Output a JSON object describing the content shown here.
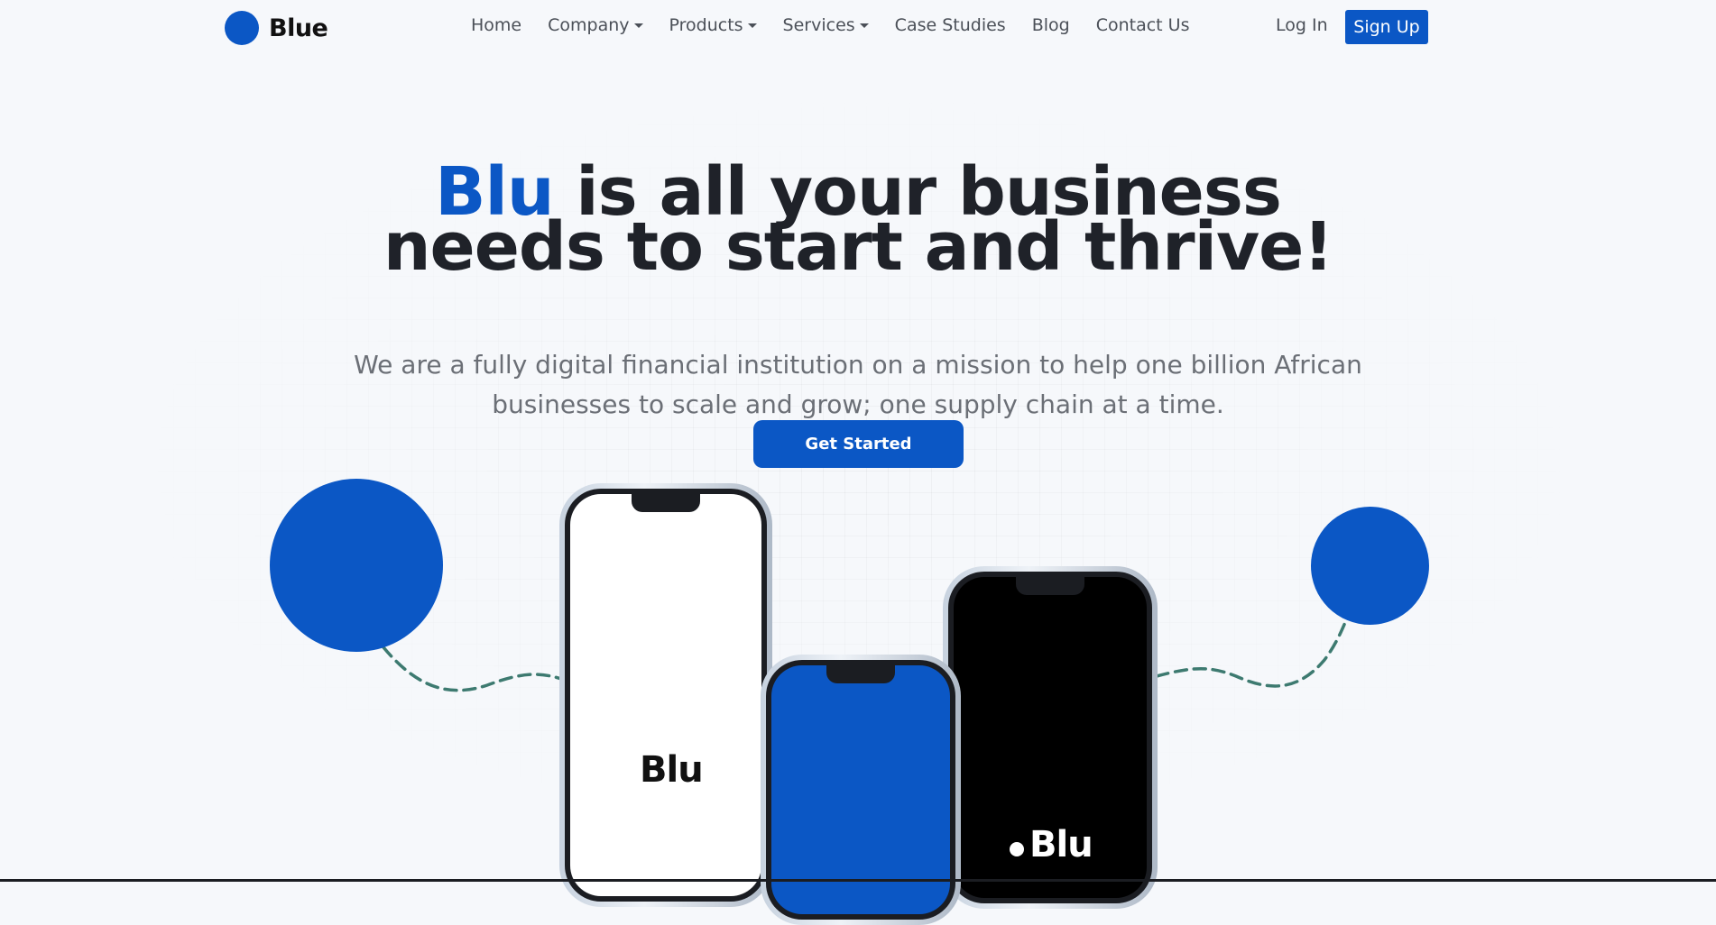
{
  "brand": {
    "name": "Blue",
    "accent_color": "#0b57c5"
  },
  "nav": {
    "items": [
      {
        "label": "Home",
        "has_dropdown": false
      },
      {
        "label": "Company",
        "has_dropdown": true
      },
      {
        "label": "Products",
        "has_dropdown": true
      },
      {
        "label": "Services",
        "has_dropdown": true
      },
      {
        "label": "Case Studies",
        "has_dropdown": false
      },
      {
        "label": "Blog",
        "has_dropdown": false
      },
      {
        "label": "Contact Us",
        "has_dropdown": false
      }
    ],
    "login_label": "Log In",
    "signup_label": "Sign Up"
  },
  "hero": {
    "headline_brand": "Blu",
    "headline_rest_line1": "is all your business",
    "headline_line2": "needs to start and thrive!",
    "subtext": "We are a fully digital financial institution on a mission to help one billion African businesses to scale and grow; one supply chain at a time.",
    "cta_label": "Get Started"
  },
  "phones": {
    "screen_1_brand": "Blu",
    "screen_3_brand": "Blu"
  },
  "colors": {
    "background": "#f6f8fb",
    "text_dark": "#1f2229",
    "text_muted": "#6b6f76",
    "dashed_line": "#3d7a70"
  }
}
